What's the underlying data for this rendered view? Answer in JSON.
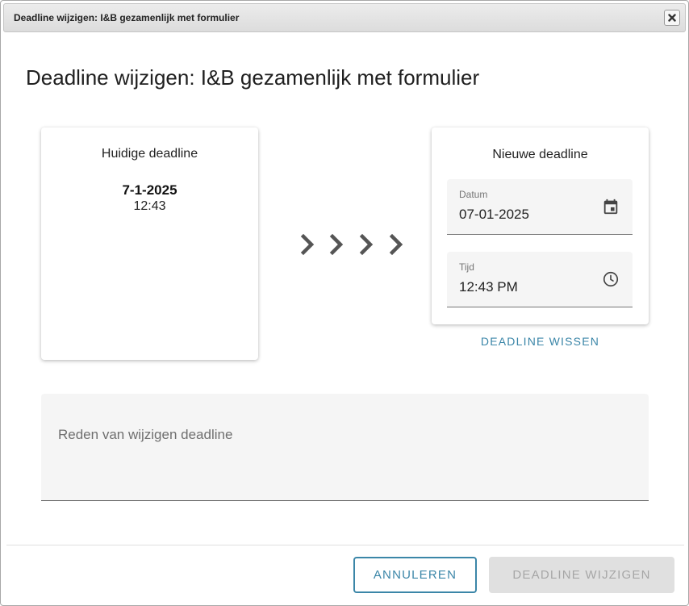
{
  "window": {
    "title": "Deadline wijzigen: I&B gezamenlijk met formulier"
  },
  "dialog": {
    "heading": "Deadline wijzigen: I&B gezamenlijk met formulier"
  },
  "current": {
    "title": "Huidige deadline",
    "date": "7-1-2025",
    "time": "12:43"
  },
  "new": {
    "title": "Nieuwe deadline",
    "date_label": "Datum",
    "date_value": "07-01-2025",
    "date_icon": "calendar-icon",
    "time_label": "Tijd",
    "time_value": "12:43 PM",
    "time_icon": "clock-icon",
    "clear_label": "DEADLINE WISSEN"
  },
  "reason": {
    "placeholder": "Reden van wijzigen deadline"
  },
  "actions": {
    "cancel_label": "ANNULEREN",
    "submit_label": "DEADLINE WIJZIGEN"
  },
  "colors": {
    "accent": "#3b86a8",
    "disabled_bg": "#e0e0e0",
    "disabled_text": "#a6a6a6"
  }
}
